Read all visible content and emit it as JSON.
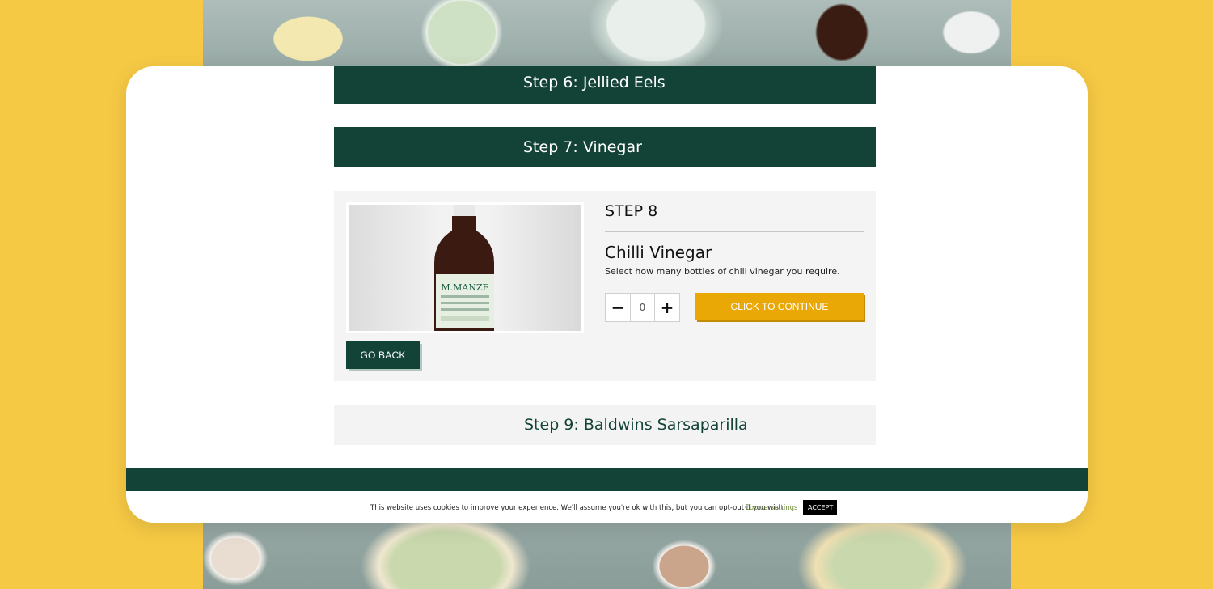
{
  "steps": {
    "step6_title": "Step 6: Jellied Eels",
    "step7_title": "Step 7: Vinegar",
    "step9_title": "Step 9: Baldwins Sarsaparilla"
  },
  "current_step": {
    "label": "STEP 8",
    "product_title": "Chilli Vinegar",
    "description": "Select how many bottles of chili vinegar you require.",
    "quantity": "0",
    "minus_symbol": "−",
    "plus_symbol": "+",
    "continue_label": "CLICK TO CONTINUE",
    "back_label": "GO BACK",
    "product_image_icon": "vinegar-bottle-photo"
  },
  "cookie_banner": {
    "message": "This website uses cookies to improve your experience. We'll assume you're ok with this, but you can opt-out if you wish.",
    "settings_label": "Cookie settings",
    "accept_label": "ACCEPT"
  },
  "colors": {
    "page_background": "#f6c944",
    "brand_green": "#134237",
    "accent_orange": "#e9a806",
    "panel_grey": "#f4f4f4"
  }
}
